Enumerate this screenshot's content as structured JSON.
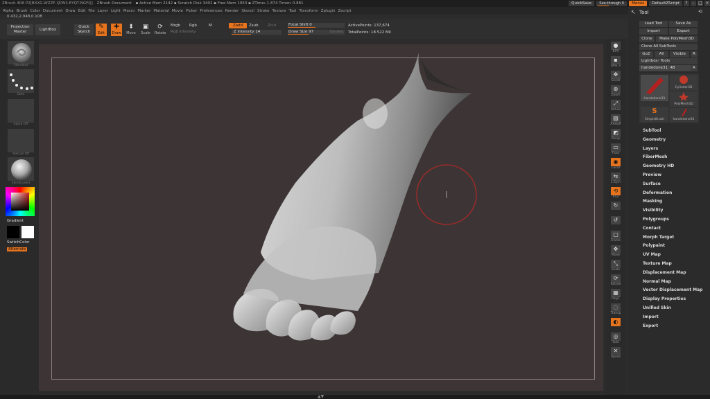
{
  "titlebar": {
    "app": "ZBrush 4R6 P2[BXXG-WZZF-QDN3-EYQT-NGFQ]",
    "doc": "ZBrush Document",
    "stats": "▪ Active Mem 2142 ▪ Scratch Disk 3402 ▪ Free Mem 1953 ▪ ZTime₂ 1.874 Timer₂ 0.881",
    "quicksave": "QuickSave",
    "see_through": "See-through  0",
    "menus": "Menus",
    "script": "DefaultZScript"
  },
  "menubar": [
    "Alpha",
    "Brush",
    "Color",
    "Document",
    "Draw",
    "Edit",
    "File",
    "Layer",
    "Light",
    "Macro",
    "Marker",
    "Material",
    "Movie",
    "Picker",
    "Preferences",
    "Render",
    "Stencil",
    "Stroke",
    "Texture",
    "Tool",
    "Transform",
    "Zplugin",
    "Zscript"
  ],
  "coords": "0.432,2.948,0.108",
  "shelf": {
    "projection_master": "Projection Master",
    "lightbox": "LightBox",
    "quick_sketch": "Quick Sketch",
    "edit": "Edit",
    "draw": "Draw",
    "move": "Move",
    "scale": "Scale",
    "rotate": "Rotate",
    "mrgb": "Mrgb",
    "rgb": "Rgb",
    "m": "M",
    "rgb_intensity": "Rgb Intensity",
    "zadd": "Zadd",
    "zsub": "Zsub",
    "zcut": "Zcut",
    "z_intensity": "Z Intensity 14",
    "focal_shift": "Focal Shift 0",
    "draw_size": "Draw Size 97",
    "dynamic": "Dynamic",
    "active_points": "ActivePoints: 137,674",
    "total_points": "TotalPoints: 18.522 Mil"
  },
  "leftpanel": {
    "brush_caption": "Standard",
    "stroke_caption": "Dots",
    "alpha_caption": "Alpha Off",
    "texture_caption": "Texture Off",
    "material_caption": "SkinShade4",
    "gradient": "Gradient",
    "switchcolor": "SwitchColor",
    "alternate": "Alternate"
  },
  "righttools": [
    {
      "name": "bpr",
      "label": "BPR"
    },
    {
      "name": "spix",
      "label": "SPix 3"
    },
    {
      "name": "scroll",
      "label": "Scroll"
    },
    {
      "name": "zoom",
      "label": "Zoom"
    },
    {
      "name": "actual",
      "label": "Actual"
    },
    {
      "name": "aahalf",
      "label": "AAHalf"
    },
    {
      "name": "persp",
      "label": "Persp"
    },
    {
      "name": "floor",
      "label": "Floor"
    },
    {
      "name": "local",
      "label": "Local"
    },
    {
      "name": "lsym",
      "label": "L.Sym"
    },
    {
      "name": "xyz",
      "label": "XYZ"
    },
    {
      "name": "rot-a",
      "label": ""
    },
    {
      "name": "rot-b",
      "label": ""
    },
    {
      "name": "frame",
      "label": "Frame"
    },
    {
      "name": "move",
      "label": "Move"
    },
    {
      "name": "scale",
      "label": "Scale"
    },
    {
      "name": "rotate",
      "label": "Rotate"
    },
    {
      "name": "polyf",
      "label": "PolyF"
    },
    {
      "name": "transp",
      "label": "Transp"
    },
    {
      "name": "ghost",
      "label": ""
    },
    {
      "name": "solo",
      "label": "Solo"
    },
    {
      "name": "xpose",
      "label": "Xpose"
    }
  ],
  "toolpanel": {
    "title": "Tool",
    "load_tool": "Load Tool",
    "save_as": "Save As",
    "import": "Import",
    "export": "Export",
    "clone": "Clone",
    "make_polymesh": "Make PolyMesh3D",
    "clone_all": "Clone All SubTools",
    "goz": "GoZ",
    "all": "All",
    "visible": "Visible",
    "r": "R",
    "lightbox_tools": "Lightbox› Tools",
    "current_tool": "handedone31. 48",
    "thumbs": {
      "main": "handedone31",
      "cylinder": "Cylinder3D",
      "polymesh": "PolyMesh3D",
      "simplebrush": "SimpleBrush",
      "handedone": "handedone31"
    },
    "items": [
      "SubTool",
      "Geometry",
      "Layers",
      "FiberMesh",
      "Geometry HD",
      "Preview",
      "Surface",
      "Deformation",
      "Masking",
      "Visibility",
      "Polygroups",
      "Contact",
      "Morph Target",
      "Polypaint",
      "UV Map",
      "Texture Map",
      "Displacement Map",
      "Normal Map",
      "Vector Displacement Map",
      "Display Properties",
      "Unified Skin",
      "Import",
      "Export"
    ]
  },
  "colors": {
    "accent": "#e6731d",
    "canvas": "#3d3535",
    "brush_ring": "#9b2a2a"
  }
}
